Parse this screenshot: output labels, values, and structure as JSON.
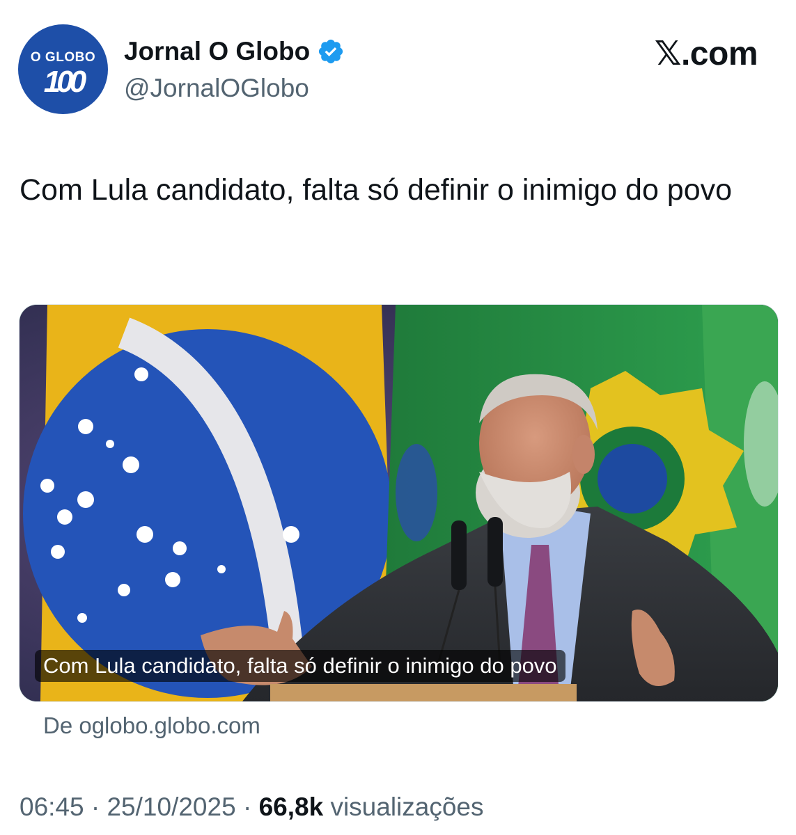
{
  "account": {
    "display_name": "Jornal O Globo",
    "handle": "@JornalOGlobo",
    "verified": true,
    "avatar_logo_top": "O GLOBO",
    "avatar_logo_number": "100",
    "avatar_color": "#1e4fa8"
  },
  "brand": {
    "site": "𝕏.com"
  },
  "tweet": {
    "text": "Com Lula candidato, falta só definir o inimigo do povo"
  },
  "card": {
    "caption": "Com Lula candidato, falta só definir o inimigo do povo",
    "source": "De oglobo.globo.com"
  },
  "meta": {
    "time": "06:45",
    "separator": "·",
    "date": "25/10/2025",
    "views_count": "66,8k",
    "views_label": "visualizações"
  },
  "colors": {
    "text_primary": "#0f1419",
    "text_secondary": "#536471",
    "verified_blue": "#1d9bf0"
  },
  "icons": {
    "verified": "verified-badge-icon"
  }
}
